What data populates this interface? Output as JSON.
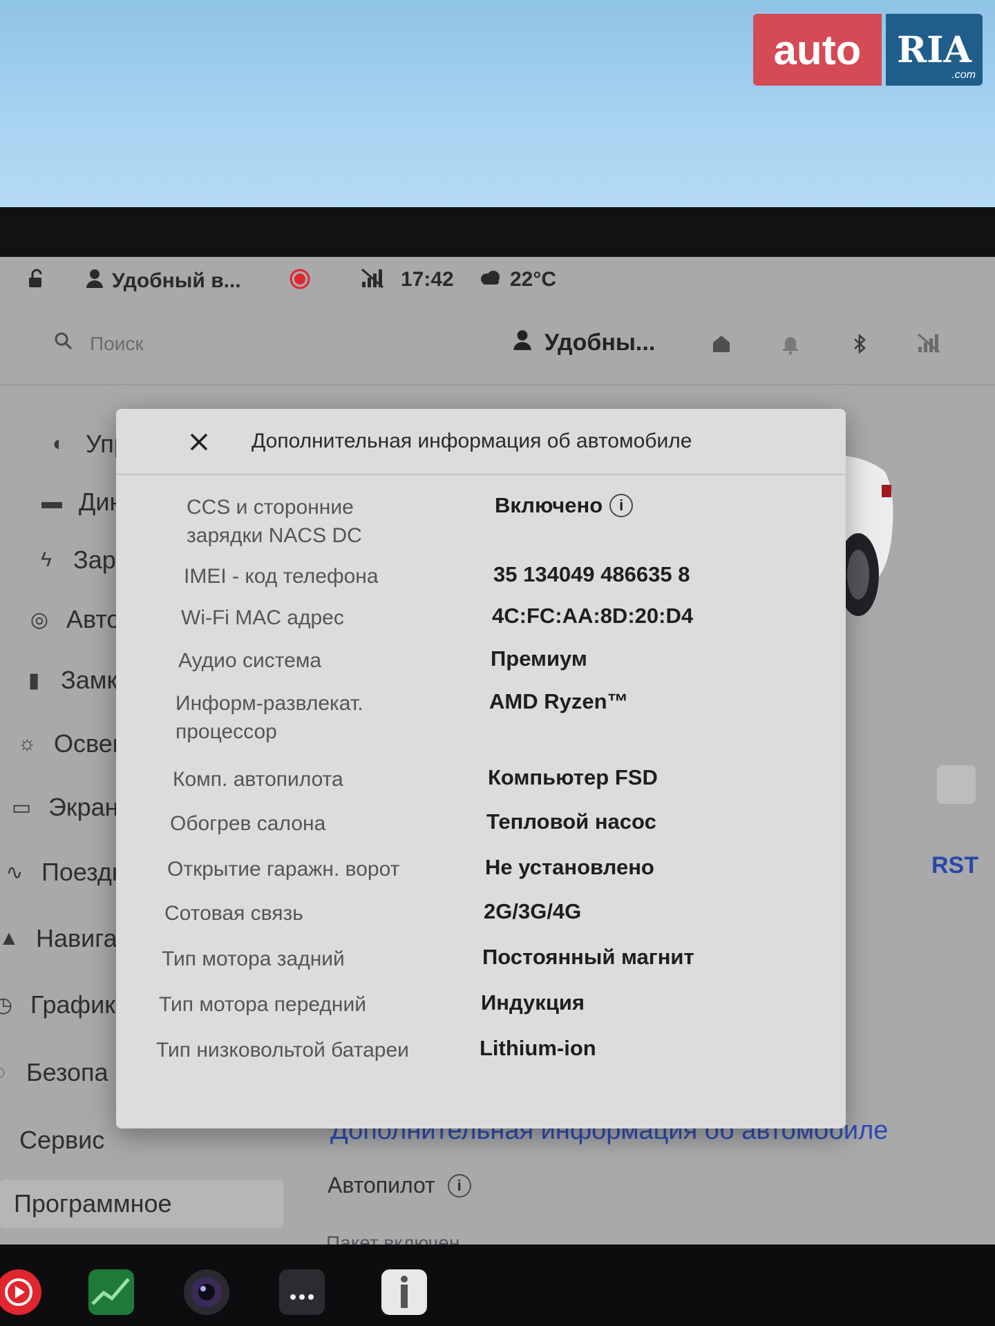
{
  "watermark": {
    "auto": "auto",
    "ria": "RIA",
    "com": ".com"
  },
  "status_bar": {
    "profile_name": "Удобный в...",
    "time": "17:42",
    "temperature": "22°C"
  },
  "top_bar": {
    "search_placeholder": "Поиск",
    "profile_name": "Удобны..."
  },
  "sidebar": {
    "items": [
      {
        "label": "Управл",
        "icon": "toggle-icon"
      },
      {
        "label": "Динамі",
        "icon": "car-icon"
      },
      {
        "label": "Зарядк",
        "icon": "bolt-icon"
      },
      {
        "label": "Автопи",
        "icon": "steering-wheel-icon"
      },
      {
        "label": "Замки",
        "icon": "lock-icon"
      },
      {
        "label": "Освещ",
        "icon": "sun-icon"
      },
      {
        "label": "Экран",
        "icon": "display-icon"
      },
      {
        "label": "Поездк",
        "icon": "trips-icon"
      },
      {
        "label": "Навига",
        "icon": "navigation-icon"
      },
      {
        "label": "График",
        "icon": "schedule-icon"
      },
      {
        "label": "Безопа",
        "icon": "safety-icon"
      },
      {
        "label": "Сервис",
        "icon": ""
      },
      {
        "label": "Программное",
        "icon": ""
      }
    ]
  },
  "background_content": {
    "right_label": "RST",
    "link": "Дополнительная информация об автомобиле",
    "autopilot_label": "Автопилот",
    "package_text": "Пакет включен"
  },
  "modal": {
    "title": "Дополнительная информация об автомобиле",
    "rows": [
      {
        "label": "CCS и сторонние зарядки NACS DC",
        "value": "Включено"
      },
      {
        "label": "IMEI - код телефона",
        "value": "35 134049 486635 8"
      },
      {
        "label": "Wi-Fi MAC адрес",
        "value": "4C:FC:AA:8D:20:D4"
      },
      {
        "label": "Аудио система",
        "value": "Премиум"
      },
      {
        "label": "Информ-развлекат. процессор",
        "value": "AMD Ryzen™"
      },
      {
        "label": "Комп. автопилота",
        "value": "Компьютер FSD"
      },
      {
        "label": "Обогрев салона",
        "value": "Тепловой насос"
      },
      {
        "label": "Открытие гаражн. ворот",
        "value": "Не установлено"
      },
      {
        "label": "Сотовая связь",
        "value": "2G/3G/4G"
      },
      {
        "label": "Тип мотора задний",
        "value": "Постоянный магнит"
      },
      {
        "label": "Тип мотора передний",
        "value": "Индукция"
      },
      {
        "label": "Тип низковольтой батареи",
        "value": "Lithium-ion"
      }
    ]
  },
  "colors": {
    "link": "#2b4bb3",
    "record": "#e0262e",
    "brand_auto": "#d44a55",
    "brand_ria": "#1f5e8a"
  }
}
